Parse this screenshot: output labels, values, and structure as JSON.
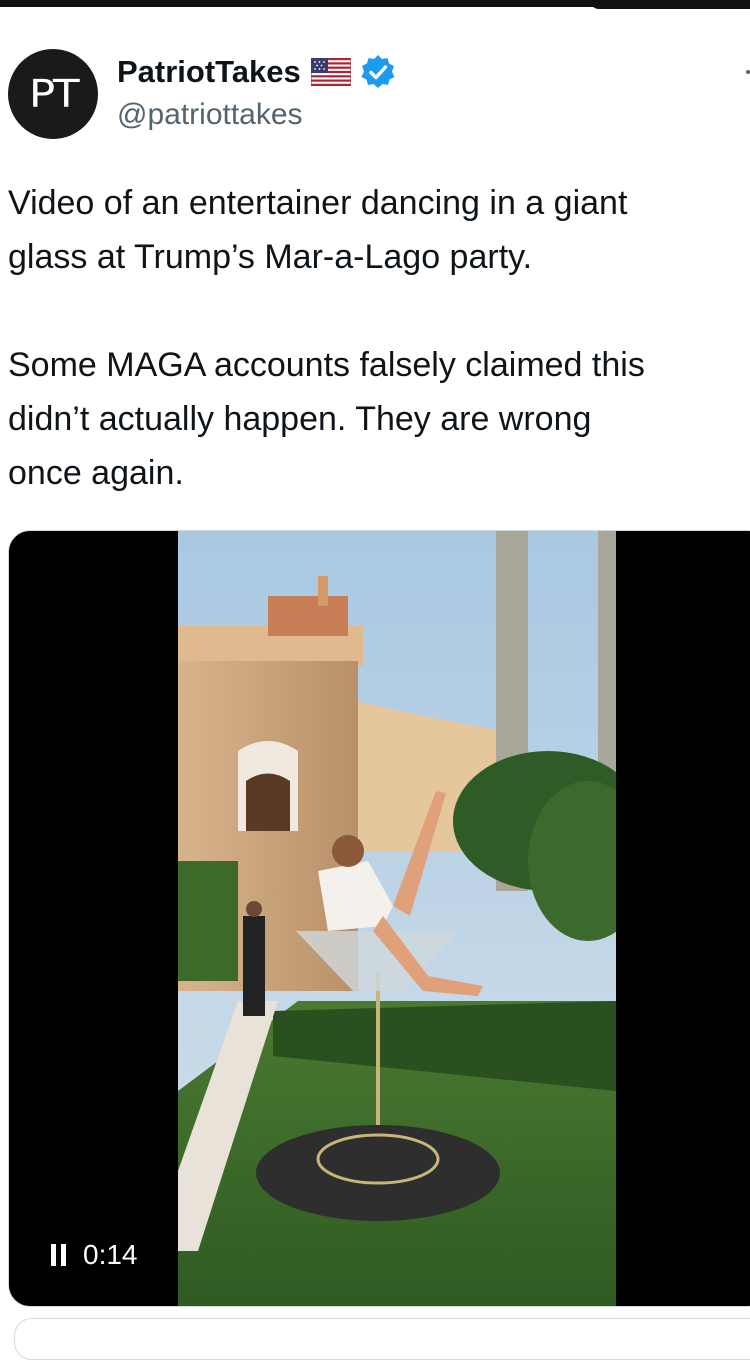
{
  "tweet": {
    "author": {
      "avatar_text": "PT",
      "name": "PatriotTakes",
      "handle": "@patriottakes"
    },
    "text": [
      "Video of an entertainer dancing in a giant glass at Trump’s Mar-a-Lago party.",
      "Some MAGA accounts falsely claimed this didn’t actually happen. They are wrong once again."
    ],
    "text_lines": [
      [
        "Video of an entertainer dancing in a giant",
        "glass at Trump’s Mar-a-Lago party."
      ],
      [
        "Some MAGA accounts falsely claimed this",
        "didn’t actually happen. They are wrong",
        "once again."
      ]
    ]
  },
  "video": {
    "timestamp": "0:14",
    "playback_icon": "pause-icon",
    "progress_fraction": null
  },
  "icons": {
    "flag": "us-flag-icon",
    "verified": "verified-badge-icon",
    "more": "more-options-icon"
  },
  "colors": {
    "verified_blue": "#1d9bf0",
    "handle_gray": "#536471",
    "text": "#0f1419",
    "video_bg": "#000000"
  }
}
